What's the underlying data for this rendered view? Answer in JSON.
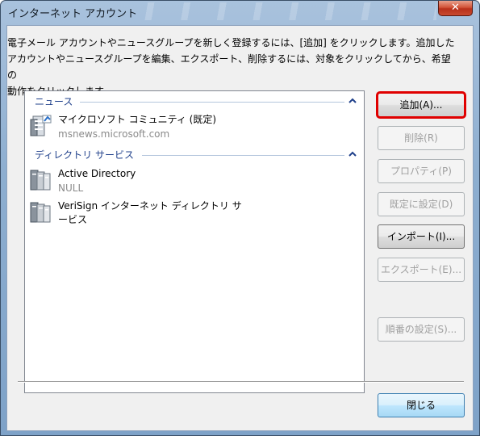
{
  "window": {
    "title": "インターネット アカウント",
    "close_glyph": "✕"
  },
  "description": {
    "line1": "電子メール アカウントやニュースグループを新しく登録するには、[追加] をクリックします。追加した",
    "line2": "アカウントやニュースグループを編集、エクスポート、削除するには、対象をクリックしてから、希望の",
    "line3": "動作をクリックします。"
  },
  "groups": [
    {
      "header": "ニュース",
      "items": [
        {
          "name": "マイクロソフト コミュニティ (既定)",
          "sub": "msnews.microsoft.com",
          "icon": "news-server-icon"
        }
      ]
    },
    {
      "header": "ディレクトリ サービス",
      "items": [
        {
          "name": "Active Directory",
          "sub": "NULL",
          "icon": "directory-server-icon"
        },
        {
          "name_line1": "VeriSign インターネット ディレクトリ サ",
          "name_line2": "ービス",
          "icon": "directory-server-icon"
        }
      ]
    }
  ],
  "buttons": {
    "add": "追加(A)...",
    "remove": "削除(R)",
    "properties": "プロパティ(P)",
    "set_default": "既定に設定(D)",
    "import": "インポート(I)...",
    "export": "エクスポート(E)...",
    "set_order": "順番の設定(S)...",
    "close": "閉じる"
  },
  "colors": {
    "highlight": "#e00000",
    "group_header": "#1e3f8a",
    "title_bar": "#8daed0"
  }
}
